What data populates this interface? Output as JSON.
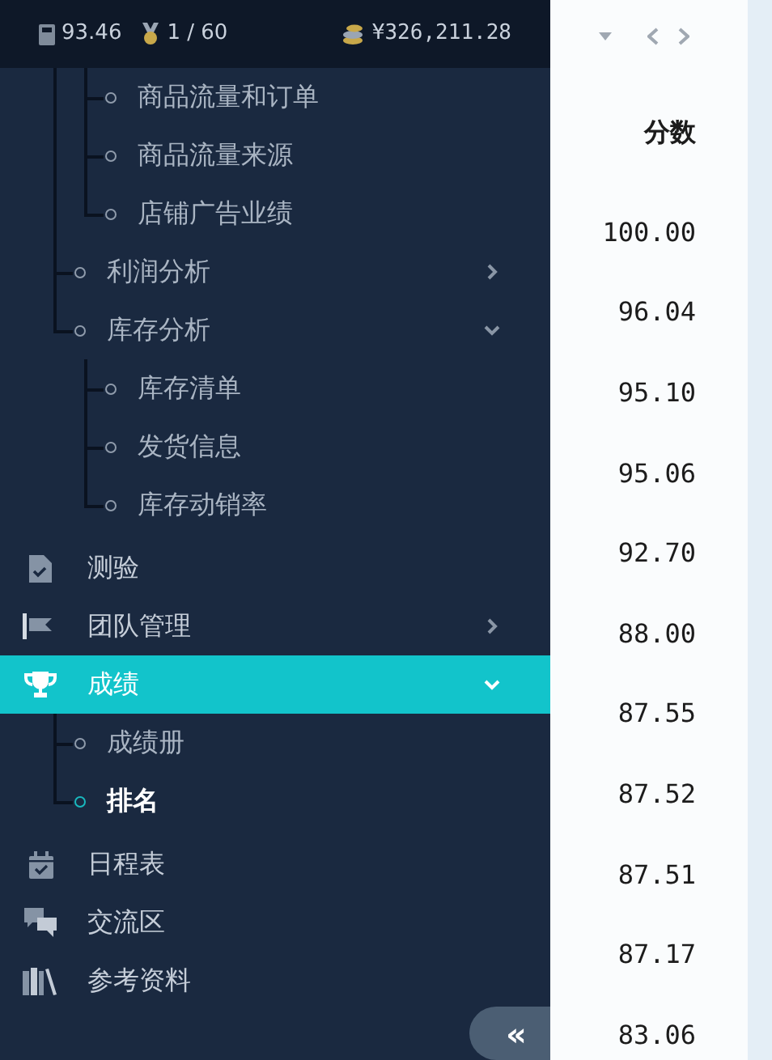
{
  "status_bar": {
    "score": "93.46",
    "rank": "1 / 60",
    "balance": "¥326,211.28"
  },
  "menu": [
    {
      "children": [
        {
          "children": [
            {
              "label": "商品流量和订单",
              "selected": false
            },
            {
              "label": "商品流量来源",
              "selected": false
            },
            {
              "label": "店铺广告业绩",
              "selected": false
            }
          ]
        },
        {
          "label": "利润分析",
          "expanded": false,
          "selected": false
        },
        {
          "label": "库存分析",
          "expanded": true,
          "selected": false,
          "children": [
            {
              "label": "库存清单",
              "selected": false
            },
            {
              "label": "发货信息",
              "selected": false
            },
            {
              "label": "库存动销率",
              "selected": false
            }
          ]
        }
      ]
    },
    {
      "label": "测验",
      "selected": false
    },
    {
      "label": "团队管理",
      "expanded": false,
      "selected": false
    },
    {
      "label": "成绩",
      "expanded": true,
      "selected": true,
      "children": [
        {
          "label": "成绩册",
          "selected": false
        },
        {
          "label": "排名",
          "selected": true
        }
      ]
    },
    {
      "label": "日程表",
      "selected": false
    },
    {
      "label": "交流区",
      "selected": false
    },
    {
      "label": "参考资料",
      "selected": false
    }
  ],
  "collapse_button": "«",
  "table": {
    "column": "分数",
    "rows": [
      "100.00",
      "96.04",
      "95.10",
      "95.06",
      "92.70",
      "88.00",
      "87.55",
      "87.52",
      "87.51",
      "87.17",
      "83.06"
    ]
  }
}
